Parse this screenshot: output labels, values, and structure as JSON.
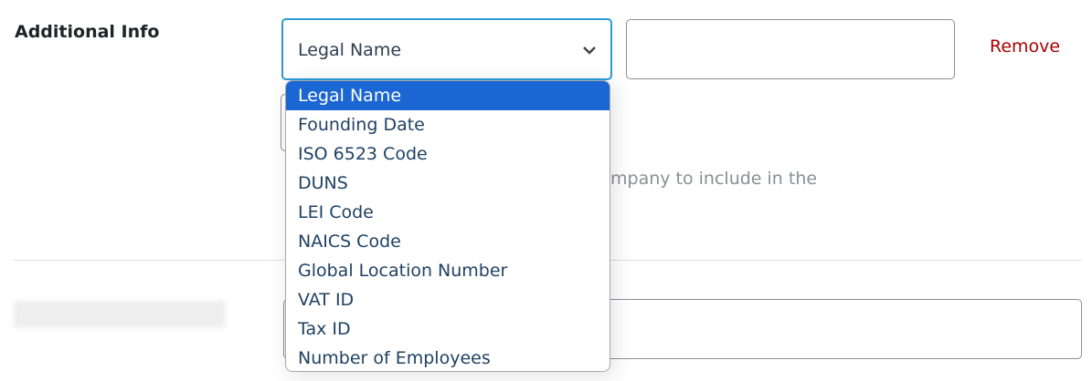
{
  "field": {
    "label": "Additional Info",
    "select_value": "Legal Name",
    "remove_label": "Remove",
    "description_visible": "mpany to include in the"
  },
  "dropdown": {
    "options": [
      "Legal Name",
      "Founding Date",
      "ISO 6523 Code",
      "DUNS",
      "LEI Code",
      "NAICS Code",
      "Global Location Number",
      "VAT ID",
      "Tax ID",
      "Number of Employees"
    ],
    "selected_index": 0
  },
  "colors": {
    "accent": "#1a66d2",
    "focus_border": "#2a9bd6",
    "remove": "#aa0000"
  }
}
